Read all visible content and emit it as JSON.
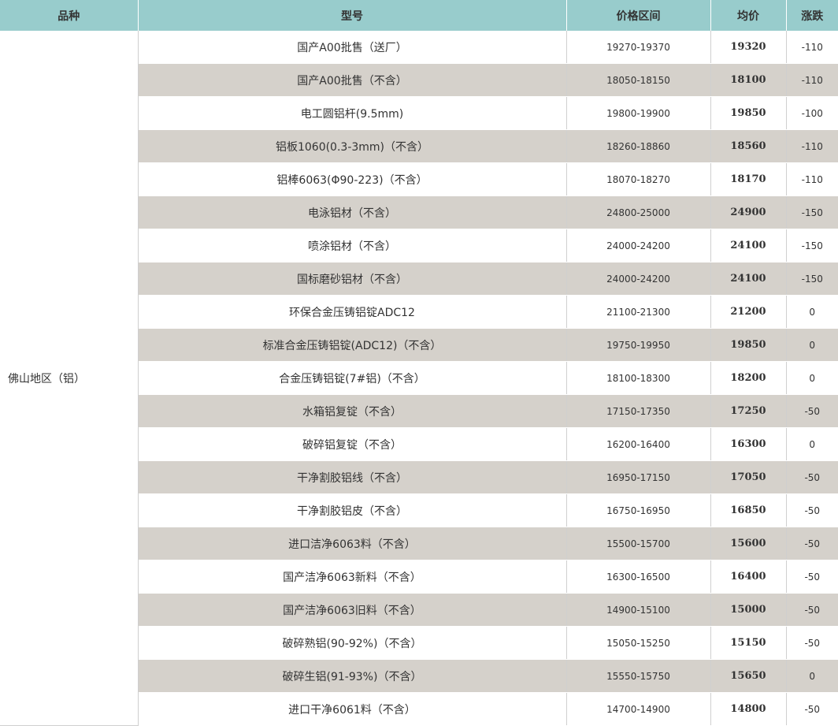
{
  "columns": {
    "category": "品种",
    "model": "型号",
    "range": "价格区间",
    "avg": "均价",
    "change": "涨跌"
  },
  "category": "佛山地区（铝）",
  "rows": [
    {
      "model": "国产A00批售（送厂）",
      "range": "19270-19370",
      "avg": "19320",
      "change": "-110"
    },
    {
      "model": "国产A00批售（不含）",
      "range": "18050-18150",
      "avg": "18100",
      "change": "-110"
    },
    {
      "model": "电工圆铝杆(9.5mm)",
      "range": "19800-19900",
      "avg": "19850",
      "change": "-100"
    },
    {
      "model": "铝板1060(0.3-3mm)（不含）",
      "range": "18260-18860",
      "avg": "18560",
      "change": "-110"
    },
    {
      "model": "铝棒6063(Φ90-223)（不含）",
      "range": "18070-18270",
      "avg": "18170",
      "change": "-110"
    },
    {
      "model": "电泳铝材（不含）",
      "range": "24800-25000",
      "avg": "24900",
      "change": "-150"
    },
    {
      "model": "喷涂铝材（不含）",
      "range": "24000-24200",
      "avg": "24100",
      "change": "-150"
    },
    {
      "model": "国标磨砂铝材（不含）",
      "range": "24000-24200",
      "avg": "24100",
      "change": "-150"
    },
    {
      "model": "环保合金压铸铝锭ADC12",
      "range": "21100-21300",
      "avg": "21200",
      "change": "0"
    },
    {
      "model": "标准合金压铸铝锭(ADC12)（不含）",
      "range": "19750-19950",
      "avg": "19850",
      "change": "0"
    },
    {
      "model": "合金压铸铝锭(7#铝)（不含）",
      "range": "18100-18300",
      "avg": "18200",
      "change": "0"
    },
    {
      "model": "水箱铝复锭（不含）",
      "range": "17150-17350",
      "avg": "17250",
      "change": "-50"
    },
    {
      "model": "破碎铝复锭（不含）",
      "range": "16200-16400",
      "avg": "16300",
      "change": "0"
    },
    {
      "model": "干净割胶铝线（不含）",
      "range": "16950-17150",
      "avg": "17050",
      "change": "-50"
    },
    {
      "model": "干净割胶铝皮（不含）",
      "range": "16750-16950",
      "avg": "16850",
      "change": "-50"
    },
    {
      "model": "进口洁净6063料（不含）",
      "range": "15500-15700",
      "avg": "15600",
      "change": "-50"
    },
    {
      "model": "国产洁净6063新料（不含）",
      "range": "16300-16500",
      "avg": "16400",
      "change": "-50"
    },
    {
      "model": "国产洁净6063旧料（不含）",
      "range": "14900-15100",
      "avg": "15000",
      "change": "-50"
    },
    {
      "model": "破碎熟铝(90-92%)（不含）",
      "range": "15050-15250",
      "avg": "15150",
      "change": "-50"
    },
    {
      "model": "破碎生铝(91-93%)（不含）",
      "range": "15550-15750",
      "avg": "15650",
      "change": "0"
    },
    {
      "model": "进口干净6061料（不含）",
      "range": "14700-14900",
      "avg": "14800",
      "change": "-50"
    }
  ],
  "colors": {
    "header_bg": "#98cccc",
    "alt_row_bg": "#d5d1cb",
    "row_bg": "#ffffff"
  }
}
